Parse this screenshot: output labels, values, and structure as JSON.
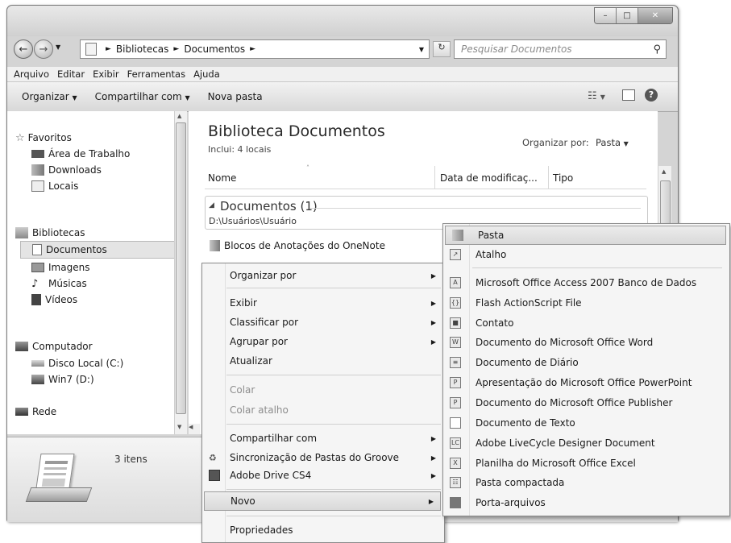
{
  "address": {
    "crumbs": [
      "Bibliotecas",
      "Documentos"
    ],
    "search_placeholder": "Pesquisar Documentos"
  },
  "menubar": [
    "Arquivo",
    "Editar",
    "Exibir",
    "Ferramentas",
    "Ajuda"
  ],
  "toolbar": {
    "organize": "Organizar",
    "share": "Compartilhar com",
    "new_folder": "Nova pasta"
  },
  "sidebar": {
    "favorites": {
      "label": "Favoritos",
      "items": [
        "Área de Trabalho",
        "Downloads",
        "Locais"
      ]
    },
    "libraries": {
      "label": "Bibliotecas",
      "items": [
        "Documentos",
        "Imagens",
        "Músicas",
        "Vídeos"
      ]
    },
    "computer": {
      "label": "Computador",
      "items": [
        "Disco Local (C:)",
        "Win7 (D:)"
      ]
    },
    "network": "Rede"
  },
  "content": {
    "title": "Biblioteca Documentos",
    "subtitle": "Inclui: 4 locais",
    "arrange_label": "Organizar por:",
    "arrange_value": "Pasta",
    "columns": [
      "Nome",
      "Data de modificaç...",
      "Tipo"
    ],
    "group_title": "Documentos (1)",
    "group_path": "D:\\Usuários\\Usuário",
    "file": "Blocos de Anotações do OneNote"
  },
  "details": {
    "count": "3 itens"
  },
  "context_menu": {
    "items": [
      {
        "label": "Organizar por",
        "sub": true
      },
      {
        "label": "Exibir",
        "sub": true
      },
      {
        "label": "Classificar por",
        "sub": true
      },
      {
        "label": "Agrupar por",
        "sub": true
      },
      {
        "label": "Atualizar"
      },
      {
        "label": "Colar",
        "disabled": true
      },
      {
        "label": "Colar atalho",
        "disabled": true
      },
      {
        "label": "Compartilhar com",
        "sub": true
      },
      {
        "label": "Sincronização de Pastas do Groove",
        "sub": true
      },
      {
        "label": "Adobe Drive CS4",
        "sub": true
      },
      {
        "label": "Novo",
        "sub": true
      },
      {
        "label": "Propriedades"
      }
    ]
  },
  "submenu": {
    "items": [
      "Pasta",
      "Atalho",
      "Microsoft Office Access 2007 Banco de Dados",
      "Flash ActionScript File",
      "Contato",
      "Documento do Microsoft Office Word",
      "Documento de Diário",
      "Apresentação do Microsoft Office PowerPoint",
      "Documento do Microsoft Office Publisher",
      "Documento de Texto",
      "Adobe LiveCycle Designer Document",
      "Planilha do Microsoft Office Excel",
      "Pasta compactada",
      "Porta-arquivos"
    ]
  }
}
